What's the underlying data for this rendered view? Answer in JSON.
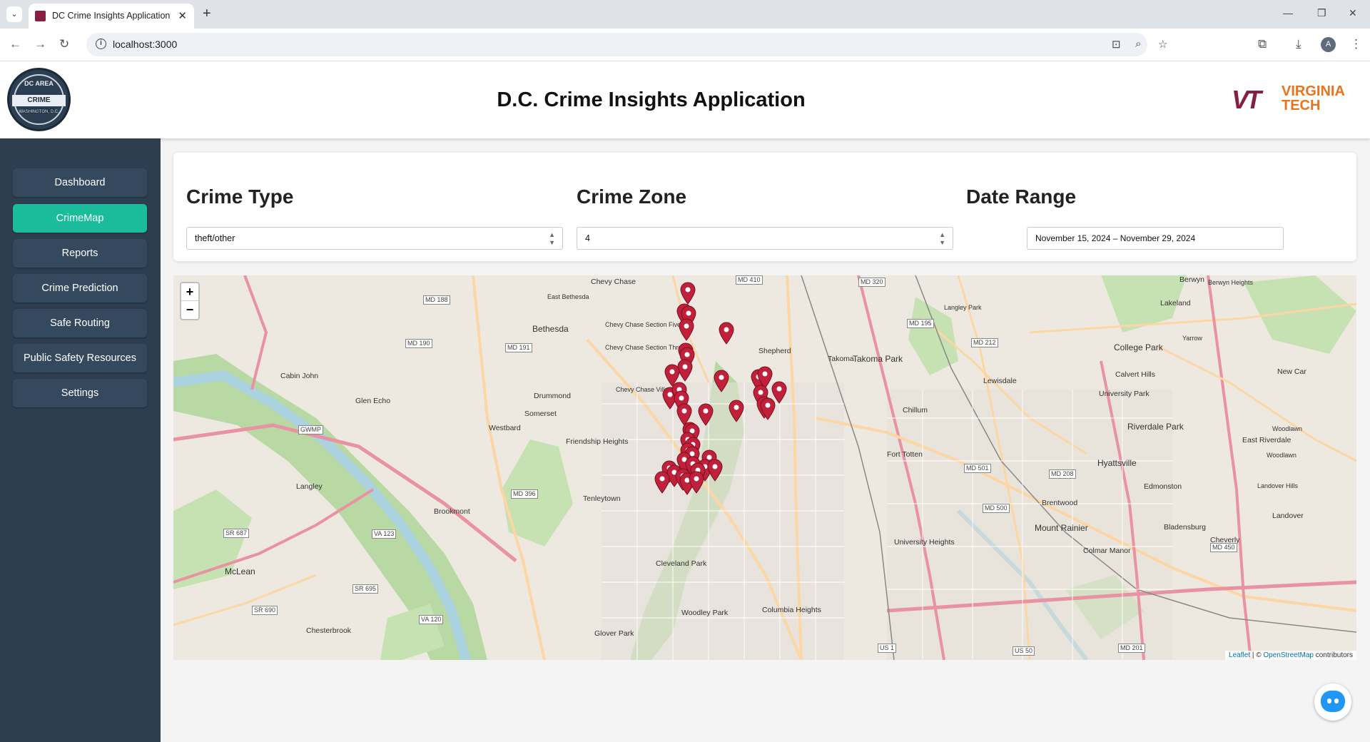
{
  "browser": {
    "tab_title": "DC Crime Insights Application",
    "url": "localhost:3000",
    "profile_initial": "A"
  },
  "header": {
    "logo_top": "DC AREA",
    "logo_main": "CRIME MONTOR",
    "logo_bottom": "WASHINGTON, D.C.",
    "title": "D.C. Crime Insights Application",
    "vt_logo_line1": "VIRGINIA",
    "vt_logo_line2": "TECH",
    "vt_logo_mark": "VT"
  },
  "sidebar": {
    "items": [
      {
        "label": "Dashboard",
        "active": false
      },
      {
        "label": "CrimeMap",
        "active": true
      },
      {
        "label": "Reports",
        "active": false
      },
      {
        "label": "Crime Prediction",
        "active": false
      },
      {
        "label": "Safe Routing",
        "active": false
      },
      {
        "label": "Public Safety Resources",
        "active": false
      },
      {
        "label": "Settings",
        "active": false
      }
    ]
  },
  "filters": {
    "crime_type_label": "Crime Type",
    "crime_type_value": "theft/other",
    "crime_zone_label": "Crime Zone",
    "crime_zone_value": "4",
    "date_range_label": "Date Range",
    "date_range_value": "November 15, 2024 – November 29, 2024"
  },
  "map": {
    "zoom_in": "+",
    "zoom_out": "−",
    "attribution_leaflet": "Leaflet",
    "attribution_sep": " | © ",
    "attribution_osm": "OpenStreetMap",
    "attribution_tail": " contributors",
    "marker_color": "#c0203a",
    "labels": {
      "bethesda": "Bethesda",
      "chevy_chase": "Chevy Chase",
      "east_bethesda": "East Bethesda",
      "takoma_park": "Takoma Park",
      "takoma": "Takoma",
      "college_park": "College Park",
      "hyattsville": "Hyattsville",
      "brentwood": "Brentwood",
      "mount_rainier": "Mount Rainier",
      "tenleytown": "Tenleytown",
      "cleveland_park": "Cleveland Park",
      "mclean": "McLean",
      "langley": "Langley",
      "chesterbrook": "Chesterbrook",
      "columbia_heights": "Columbia Heights",
      "fort_totten": "Fort Totten",
      "friendship_heights": "Friendship Heights",
      "westbard": "Westbard",
      "somerset": "Somerset",
      "drummond": "Drummond",
      "glen_echo": "Glen Echo",
      "cabin_john": "Cabin John",
      "lewisdale": "Lewisdale",
      "riverdale_park": "Riverdale Park",
      "east_riverdale": "East Riverdale",
      "bladensburg": "Bladensburg",
      "woodley_park": "Woodley Park",
      "glover_park": "Glover Park",
      "university_heights": "University Heights",
      "brookmont": "Brookmont",
      "chillum": "Chillum",
      "shepherd": "Shepherd",
      "edmonston": "Edmonston",
      "landover": "Landover",
      "berwyn": "Berwyn",
      "langley_park": "Langley Park",
      "calvert_hills": "Calvert Hills",
      "university_park": "University Park",
      "new_car": "New Car",
      "woodlawn": "Woodlawn",
      "landover_hills": "Landover Hills",
      "cheverly": "Cheverly",
      "colmar_manor": "Colmar Manor",
      "berwyn_heights": "Berwyn Heights",
      "lakeland": "Lakeland",
      "yarrow": "Yarrow",
      "chevy_chase_village": "Chevy Chase Village",
      "chevy_chase_five": "Chevy Chase Section Five",
      "chevy_chase_three": "Chevy Chase Section Three"
    },
    "highways": [
      "MD 410",
      "MD 320",
      "MD 188",
      "MD 190",
      "MD 191",
      "MD 195",
      "MD 212",
      "MD 501",
      "MD 208",
      "MD 500",
      "MD 450",
      "MD 396",
      "VA 123",
      "VA 120",
      "SR 687",
      "SR 695",
      "SR 690",
      "US 1",
      "US 50",
      "MD 201",
      "GWMP"
    ]
  }
}
